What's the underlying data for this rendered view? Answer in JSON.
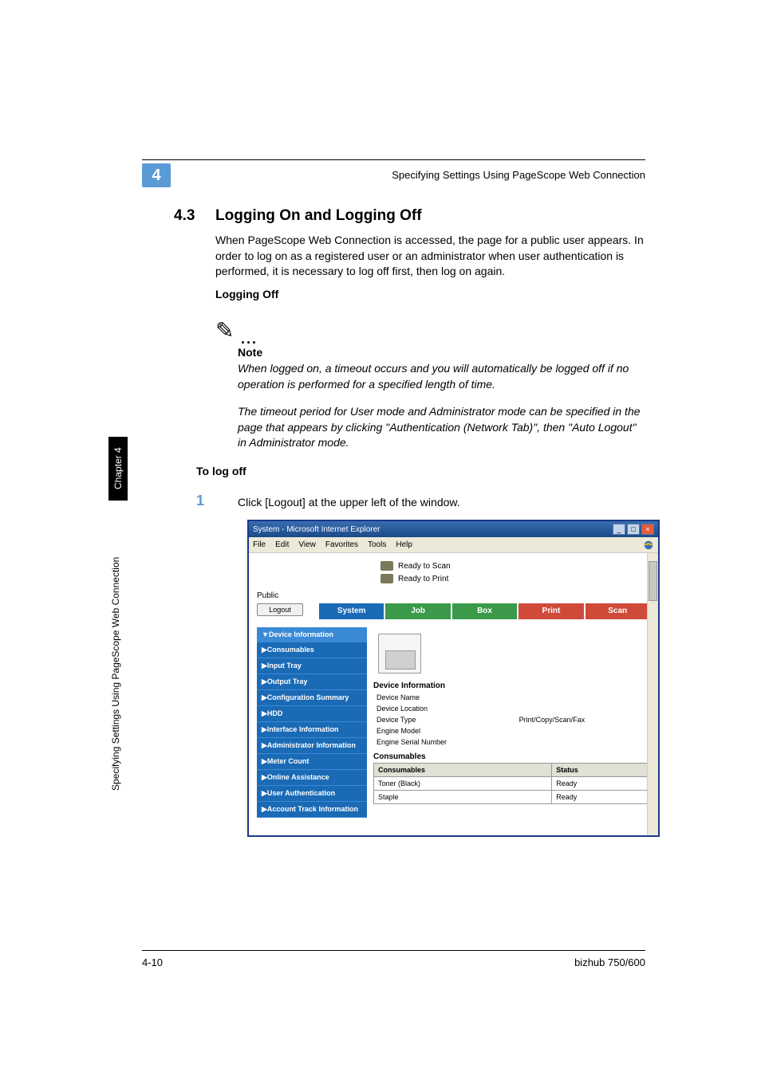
{
  "header": {
    "chapter_number": "4",
    "header_text": "Specifying Settings Using PageScope Web Connection"
  },
  "section": {
    "number": "4.3",
    "title": "Logging On and Logging Off",
    "intro": "When PageScope Web Connection is accessed, the page for a public user appears. In order to log on as a registered user or an administrator when user authentication is performed, it is necessary to log off first, then log on again."
  },
  "subheading_logging_off": "Logging Off",
  "note": {
    "label": "Note",
    "para1": "When logged on, a timeout occurs and you will automatically be logged off if no operation is performed for a specified length of time.",
    "para2": "The timeout period for User mode and Administrator mode can be specified in the page that appears by clicking \"Authentication (Network Tab)\", then \"Auto Logout\" in Administrator mode."
  },
  "subheading_to_log_off": "To log off",
  "step": {
    "num": "1",
    "text": "Click [Logout] at the upper left of the window."
  },
  "sidebar": {
    "chapter": "Chapter 4",
    "text": "Specifying Settings Using PageScope Web Connection"
  },
  "screenshot": {
    "title": "System - Microsoft Internet Explorer",
    "menu": {
      "file": "File",
      "edit": "Edit",
      "view": "View",
      "favorites": "Favorites",
      "tools": "Tools",
      "help": "Help"
    },
    "status": {
      "ready_scan": "Ready to Scan",
      "ready_print": "Ready to Print"
    },
    "public": "Public",
    "logout": "Logout",
    "tabs": {
      "system": "System",
      "job": "Job",
      "box": "Box",
      "print": "Print",
      "scan": "Scan"
    },
    "sidebar_items": [
      "▼Device Information",
      "▶Consumables",
      "▶Input Tray",
      "▶Output Tray",
      "▶Configuration Summary",
      "▶HDD",
      "▶Interface Information",
      "▶Administrator Information",
      "▶Meter Count",
      "▶Online Assistance",
      "▶User Authentication",
      "▶Account Track Information"
    ],
    "device_info": {
      "heading": "Device Information",
      "rows": [
        {
          "label": "Device Name",
          "value": ""
        },
        {
          "label": "Device Location",
          "value": ""
        },
        {
          "label": "Device Type",
          "value": "Print/Copy/Scan/Fax"
        },
        {
          "label": "Engine Model",
          "value": ""
        },
        {
          "label": "Engine Serial Number",
          "value": ""
        }
      ]
    },
    "consumables": {
      "heading": "Consumables",
      "col1": "Consumables",
      "col2": "Status",
      "rows": [
        {
          "name": "Toner (Black)",
          "status": "Ready"
        },
        {
          "name": "Staple",
          "status": "Ready"
        }
      ]
    }
  },
  "footer": {
    "page": "4-10",
    "product": "bizhub 750/600"
  }
}
